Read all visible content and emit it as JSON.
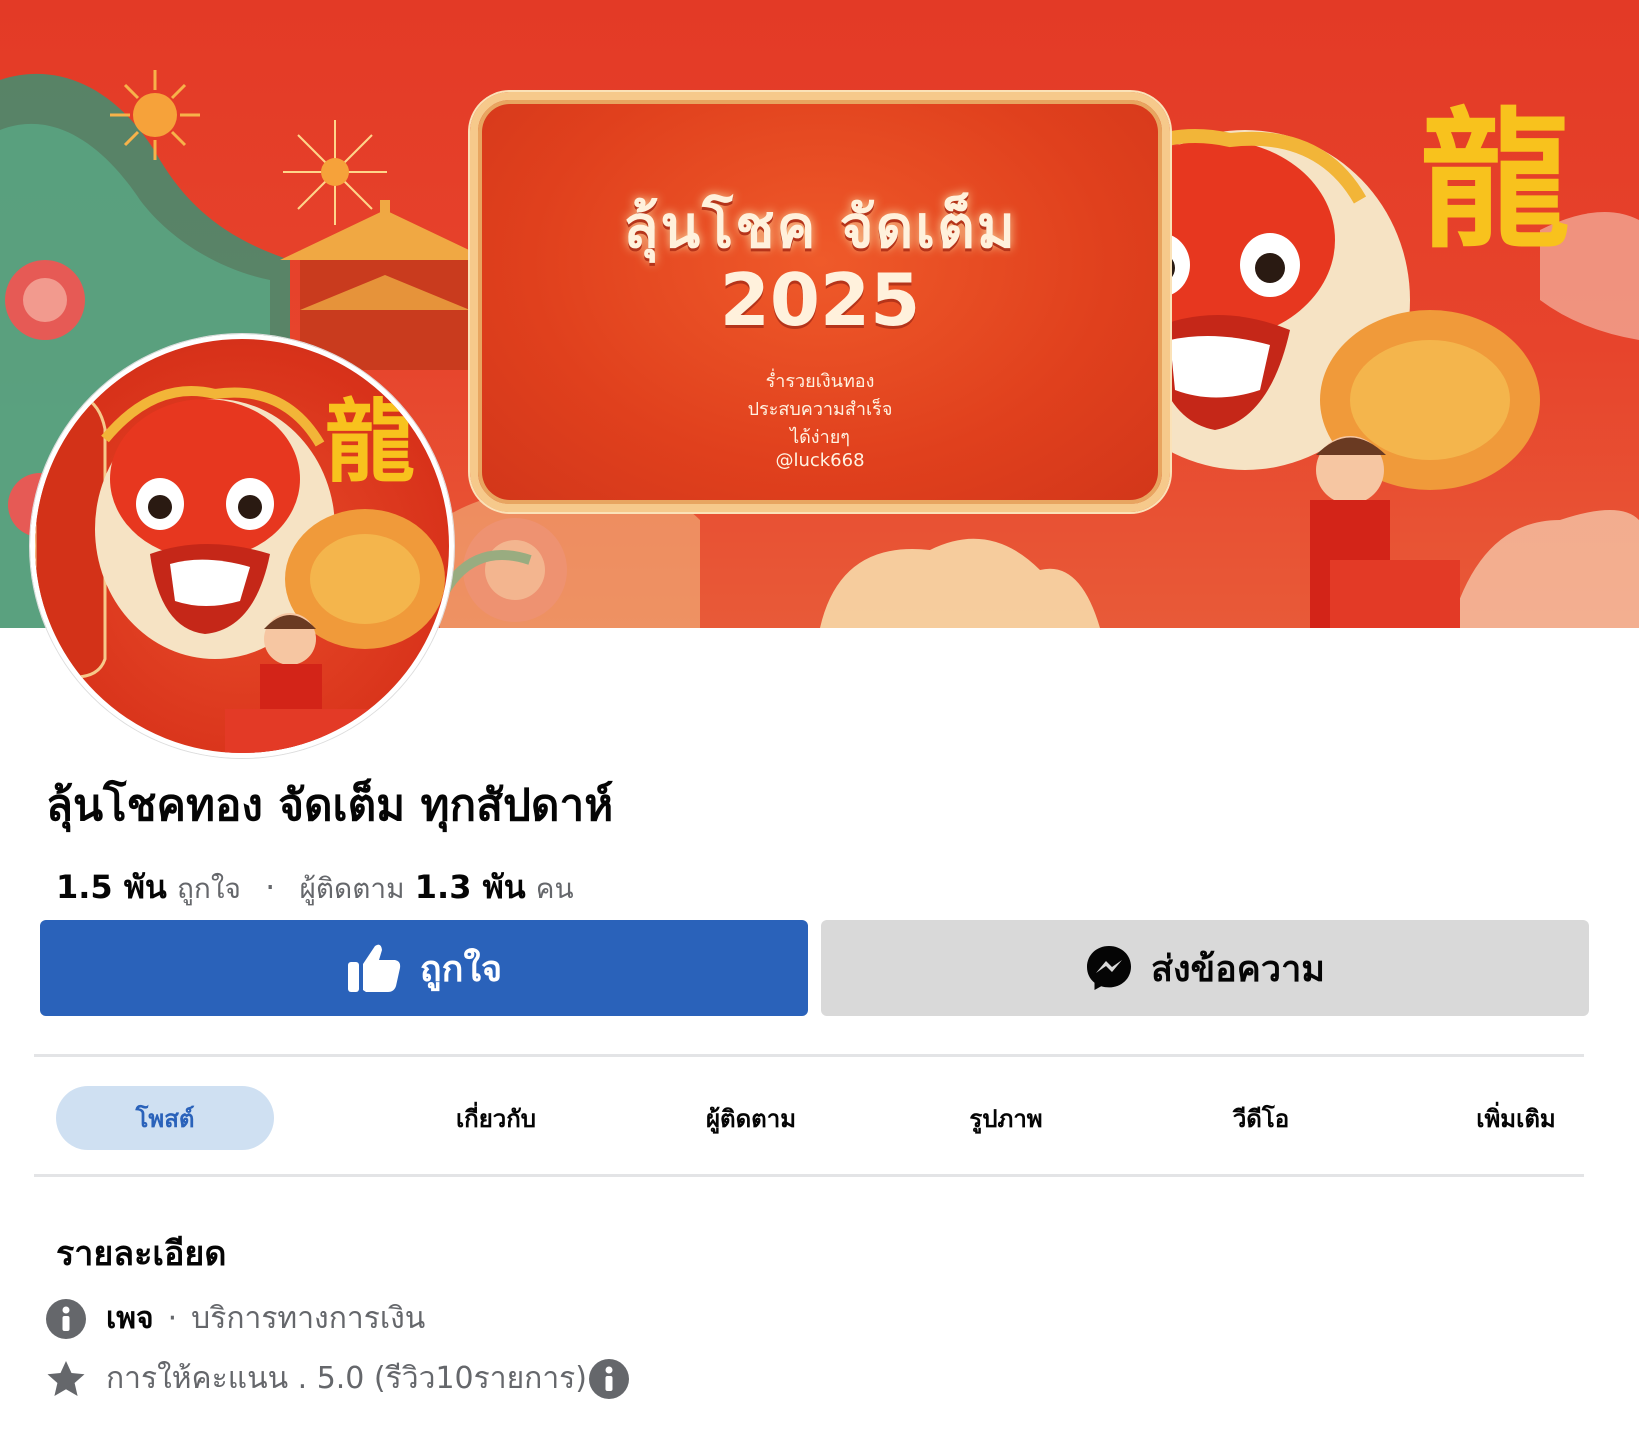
{
  "cover": {
    "title_line1": "ลุ้นโชค จัดเต็ม",
    "title_line2": "2025",
    "subtitle_lines": [
      "ร่ำรวยเงินทอง",
      "ประสบความสำเร็จ",
      "ได้ง่ายๆ",
      "@luck668"
    ],
    "hanzi": "龍"
  },
  "profile": {
    "name": "ลุ้นโชคทอง จัดเต็ม ทุกสัปดาห์",
    "likes_count": "1.5 พัน",
    "likes_label": "ถูกใจ",
    "followers_label": "ผู้ติดตาม",
    "followers_count": "1.3 พัน",
    "followers_unit": "คน"
  },
  "actions": {
    "like_label": "ถูกใจ",
    "message_label": "ส่งข้อความ"
  },
  "tabs": [
    "โพสต์",
    "เกี่ยวกับ",
    "ผู้ติดตาม",
    "รูปภาพ",
    "วีดีโอ",
    "เพิ่มเติม"
  ],
  "details": {
    "heading": "รายละเอียด",
    "page_type": "เพจ",
    "separator": "·",
    "category": "บริการทางการเงิน",
    "rating_text": "การให้คะแนน . 5.0 (รีวิว10รายการ)"
  },
  "colors": {
    "primary_blue": "#2a62ba",
    "cover_red": "#e33a26",
    "tab_active_bg": "#cfe0f2"
  },
  "icons": [
    "thumbs-up-icon",
    "messenger-icon",
    "info-icon",
    "star-icon"
  ]
}
